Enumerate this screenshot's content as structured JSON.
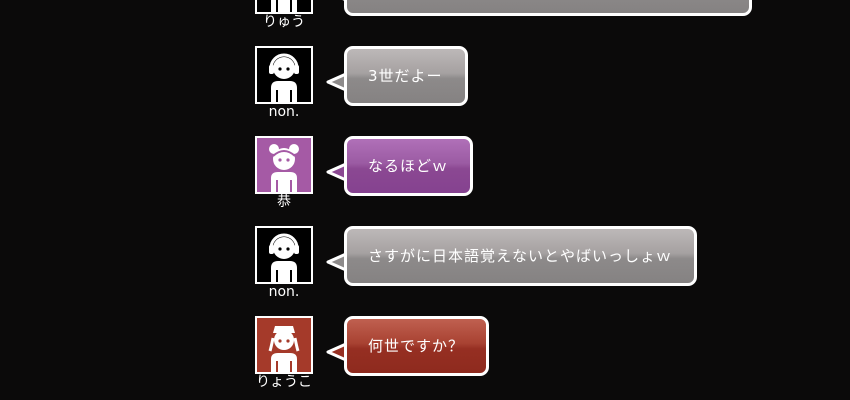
{
  "messages": [
    {
      "name": "りゅう",
      "text": "",
      "style": "gray",
      "avatar": "headphone-person-icon",
      "avatar_bg": "#000000"
    },
    {
      "name": "non.",
      "text": "3世だよー",
      "style": "gray",
      "avatar": "headphone-person-icon",
      "avatar_bg": "#000000"
    },
    {
      "name": "恭",
      "text": "なるほどｗ",
      "style": "purple",
      "avatar": "bun-hair-person-icon",
      "avatar_bg": "#a55aa5"
    },
    {
      "name": "non.",
      "text": "さすがに日本語覚えないとやばいっしょｗ",
      "style": "gray",
      "avatar": "headphone-person-icon",
      "avatar_bg": "#000000"
    },
    {
      "name": "りょうこ",
      "text": "何世ですか？",
      "style": "red",
      "avatar": "nurse-person-icon",
      "avatar_bg": "#a53a2a"
    }
  ],
  "colors": {
    "background": "#0b0a0a",
    "gray_bubble": "#959191",
    "purple_bubble": "#9b5ba3",
    "red_bubble": "#a23a2b",
    "border": "#ffffff"
  }
}
